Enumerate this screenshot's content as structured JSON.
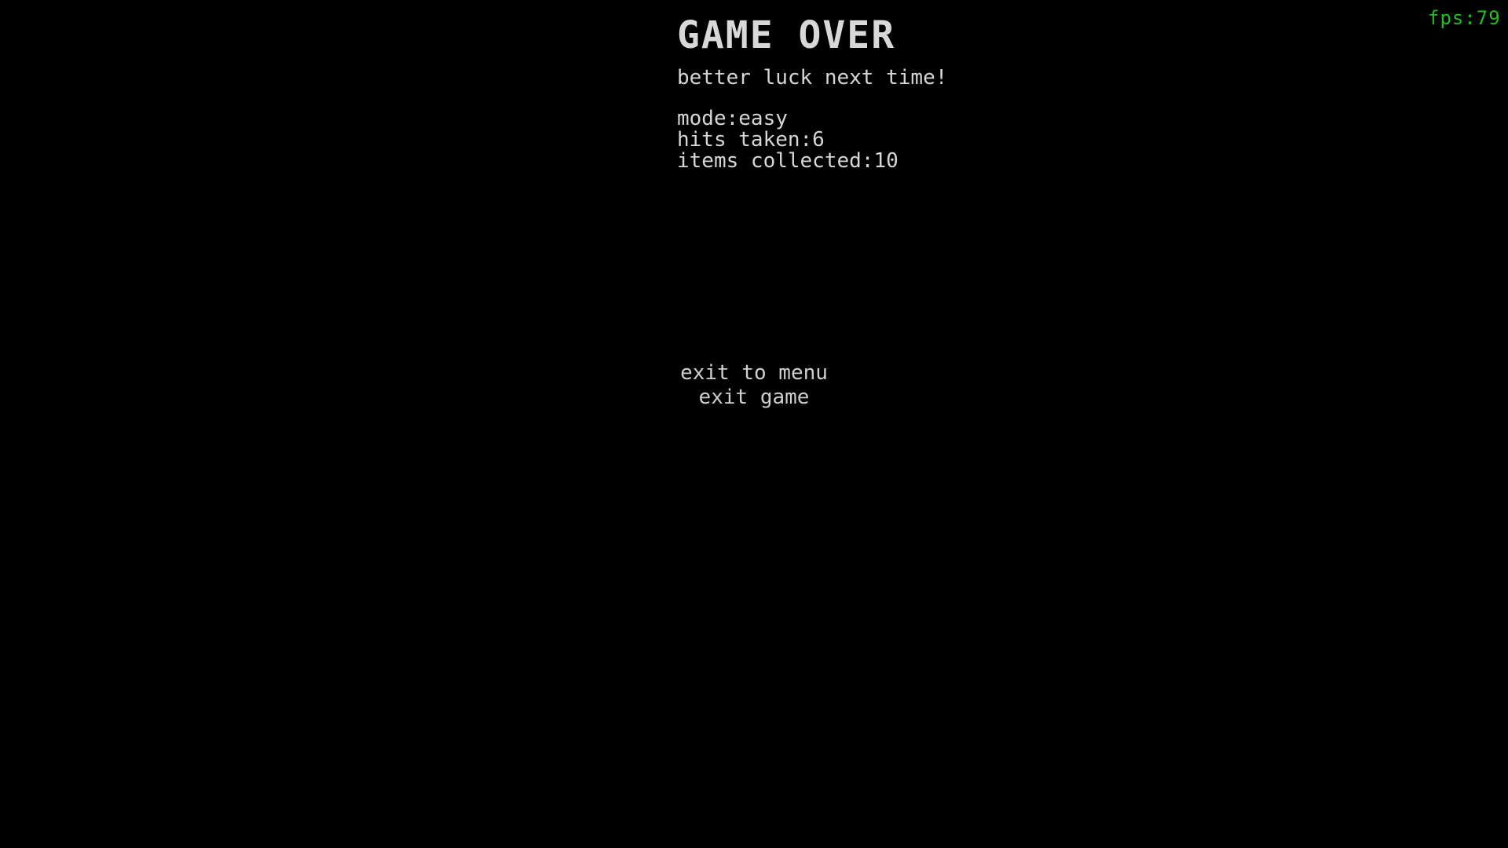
{
  "hud": {
    "fps_text": "fps:79"
  },
  "game_over": {
    "title": "GAME OVER",
    "subtitle": "better luck next time!",
    "stats": [
      "mode:easy",
      "hits taken:6",
      "items collected:10"
    ]
  },
  "menu": {
    "items": [
      "exit to menu",
      "exit game"
    ]
  },
  "colors": {
    "background": "#000000",
    "text": "#d6d6d6",
    "fps": "#1fbf1f"
  }
}
